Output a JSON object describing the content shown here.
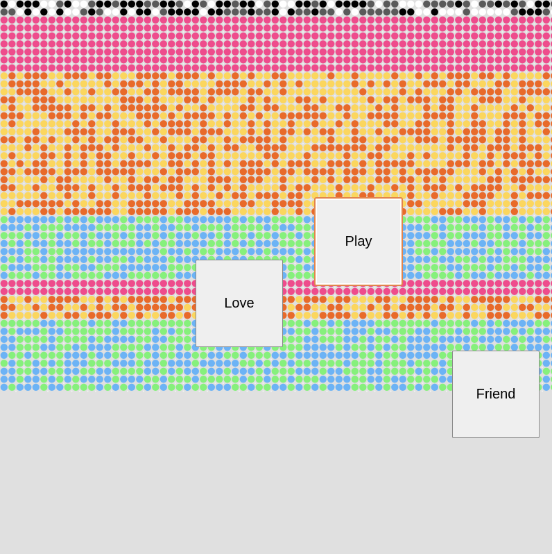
{
  "palette": {
    "black": "#000000",
    "gray": "#5a5a5a",
    "white": "#ffffff",
    "pink": "#ee4c8c",
    "yellow": "#fbd65e",
    "orange": "#e86a2a",
    "green": "#86f07c",
    "blue": "#6cb3f5",
    "background": "#e0e0e0",
    "tile_fill": "#efefef",
    "tile_selected_outline": "#e2844c"
  },
  "dot_bands": [
    {
      "name": "mono-band",
      "colors": [
        "black",
        "gray",
        "white"
      ]
    },
    {
      "name": "pink-band-top",
      "colors": [
        "pink"
      ]
    },
    {
      "name": "warm-band-top",
      "colors": [
        "yellow",
        "orange"
      ]
    },
    {
      "name": "cool-band-top",
      "colors": [
        "green",
        "blue"
      ]
    },
    {
      "name": "pink-band-mid",
      "colors": [
        "pink"
      ]
    },
    {
      "name": "warm-band-mid",
      "colors": [
        "yellow",
        "orange"
      ]
    },
    {
      "name": "cool-band-bottom",
      "colors": [
        "green",
        "blue"
      ]
    }
  ],
  "tiles": [
    {
      "id": "play",
      "label": "Play",
      "selected": true,
      "icon": "none"
    },
    {
      "id": "love",
      "label": "Love",
      "selected": false,
      "icon": "none"
    },
    {
      "id": "friend",
      "label": "Friend",
      "selected": false,
      "icon": "none"
    }
  ]
}
